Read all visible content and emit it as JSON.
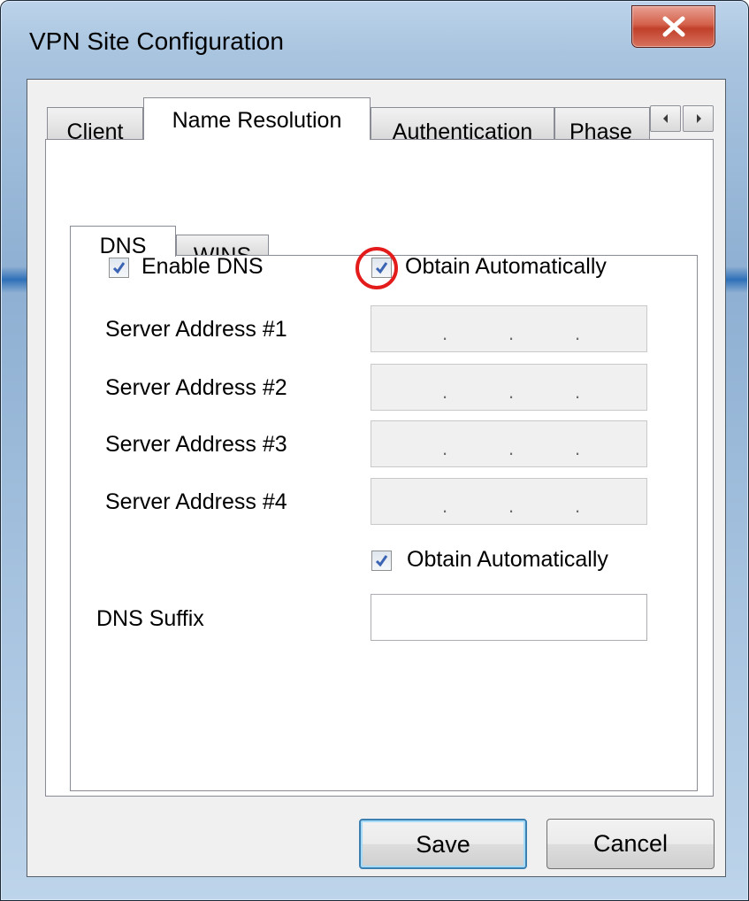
{
  "window": {
    "title": "VPN Site Configuration",
    "close_icon": "close-x-icon"
  },
  "outer_tabs": [
    {
      "label": "Client",
      "active": false
    },
    {
      "label": "Name Resolution",
      "active": true
    },
    {
      "label": "Authentication",
      "active": false
    },
    {
      "label": "Phase",
      "active": false
    }
  ],
  "tab_scroll": {
    "left_icon": "arrow-left-icon",
    "right_icon": "arrow-right-icon"
  },
  "inner_tabs": [
    {
      "label": "DNS",
      "active": true
    },
    {
      "label": "WINS",
      "active": false
    }
  ],
  "dns": {
    "enable_dns": {
      "label": "Enable DNS",
      "checked": true
    },
    "obtain_auto_servers": {
      "label": "Obtain Automatically",
      "checked": true
    },
    "servers": [
      {
        "label": "Server Address #1",
        "value": ""
      },
      {
        "label": "Server Address #2",
        "value": ""
      },
      {
        "label": "Server Address #3",
        "value": ""
      },
      {
        "label": "Server Address #4",
        "value": ""
      }
    ],
    "obtain_auto_suffix": {
      "label": "Obtain Automatically",
      "checked": true
    },
    "suffix": {
      "label": "DNS Suffix",
      "value": ""
    }
  },
  "buttons": {
    "save": "Save",
    "cancel": "Cancel"
  },
  "colors": {
    "highlight": "#e31b1b",
    "default_button_border": "#3c7fb1",
    "check": "#3b64b4"
  }
}
